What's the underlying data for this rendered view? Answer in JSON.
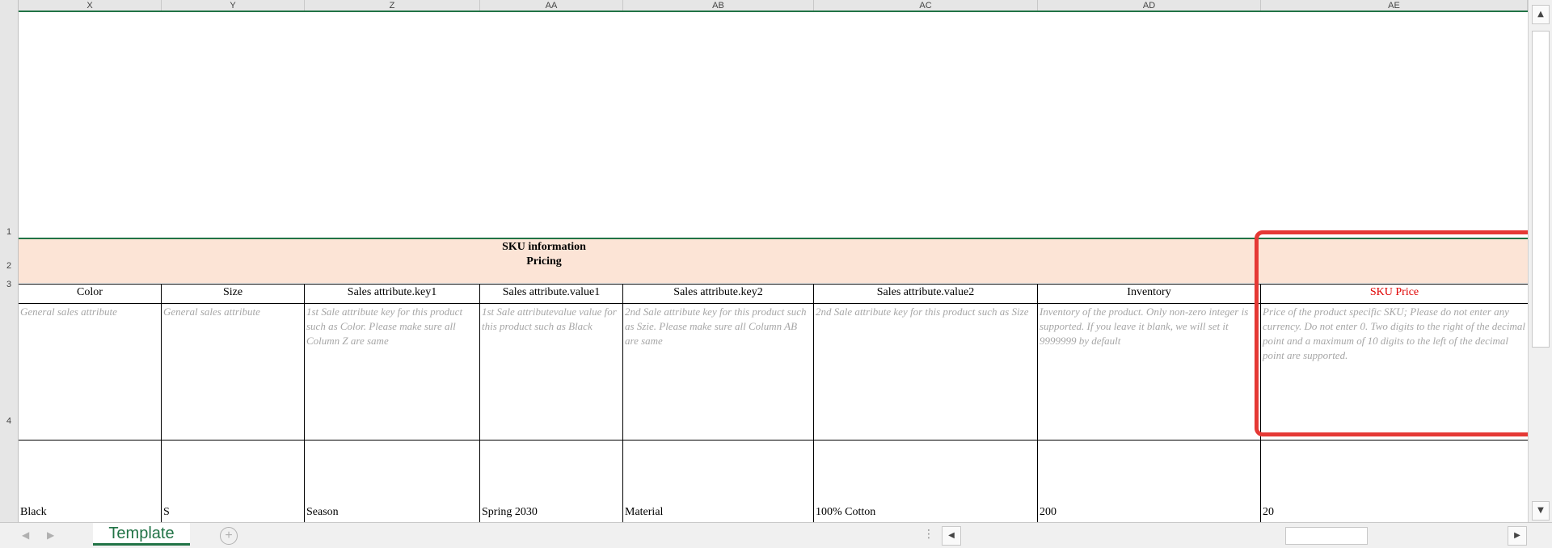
{
  "columns": [
    "X",
    "Y",
    "Z",
    "AA",
    "AB",
    "AC",
    "AD",
    "AE"
  ],
  "rows": [
    "1",
    "2",
    "3",
    "4"
  ],
  "section_title": "SKU information",
  "section_subtitle": "Pricing",
  "headers": [
    {
      "label": "Color",
      "required": false
    },
    {
      "label": "Size",
      "required": false
    },
    {
      "label": "Sales attribute.key1",
      "required": false
    },
    {
      "label": "Sales attribute.value1",
      "required": false
    },
    {
      "label": "Sales attribute.key2",
      "required": false
    },
    {
      "label": "Sales attribute.value2",
      "required": false
    },
    {
      "label": "Inventory",
      "required": false
    },
    {
      "label": "SKU Price",
      "required": true
    }
  ],
  "descriptions": [
    "General sales attribute",
    "General sales attribute",
    "1st Sale attribute key for this product such as Color. Please make sure all Column Z are same",
    "1st Sale attributevalue value for this product such as Black",
    "2nd Sale attribute key for this product such as Szie. Please make sure all Column AB are same",
    "2nd Sale attribute key for this product such as Size",
    "Inventory of the product. Only non-zero integer is supported. If you leave it blank, we will set it 9999999 by default",
    "Price of the product specific SKU; Please do not enter any currency. Do not enter 0. Two digits to the right of the decimal point and a maximum of 10 digits to the left of the decimal point are supported."
  ],
  "values": [
    "Black",
    "S",
    "Season",
    "Spring 2030",
    "Material",
    "100% Cotton",
    "200",
    "20"
  ],
  "sheet_tab": "Template",
  "add_sheet_glyph": "+",
  "colors": {
    "accent": "#217346",
    "band": "#fce4d6",
    "required_text": "#e00000",
    "highlight": "#e53935"
  },
  "icons": [
    "scroll-up-icon",
    "scroll-down-icon",
    "scroll-left-icon",
    "scroll-right-icon",
    "sheet-prev-icon",
    "sheet-next-icon",
    "add-sheet-icon",
    "more-options-icon"
  ]
}
